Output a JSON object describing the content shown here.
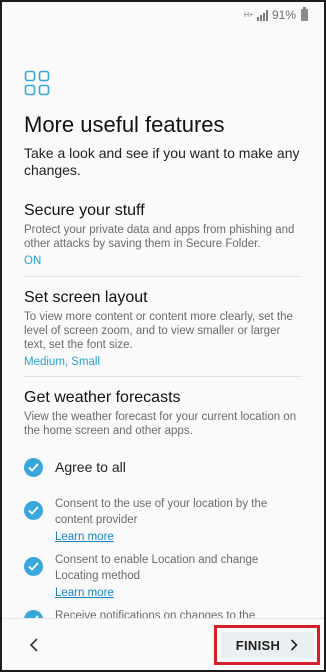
{
  "status_bar": {
    "network_type": "H+",
    "battery_percent": "91%"
  },
  "icons": {
    "page_icon": "apps-grid-icon",
    "back": "chevron-left-icon",
    "finish_arrow": "chevron-right-icon",
    "check": "checkmark-icon"
  },
  "colors": {
    "accent_blue": "#3aa7da",
    "link_blue": "#1a84c6",
    "highlight_red": "#d4202b"
  },
  "page": {
    "title": "More useful features",
    "subtitle": "Take a look and see if you want to make any changes."
  },
  "sections": [
    {
      "title": "Secure your stuff",
      "description": "Protect your private data and apps from phishing and other attacks by saving them in Secure Folder.",
      "value": "ON"
    },
    {
      "title": "Set screen layout",
      "description": "To view more content or content more clearly, set the level of screen zoom, and to view smaller or larger text, set the font size.",
      "value": "Medium, Small"
    },
    {
      "title": "Get weather forecasts",
      "description": "View the weather forecast for your current location on the home screen and other apps."
    }
  ],
  "weather_options": {
    "agree_all": "Agree to all",
    "items": [
      {
        "text": "Consent to the use of your location by the content provider",
        "link": "Learn more"
      },
      {
        "text": "Consent to enable Location and change Locating method",
        "link": "Learn more"
      },
      {
        "text": "Receive notifications on changes to the"
      }
    ]
  },
  "navigation": {
    "finish_label": "FINISH"
  }
}
